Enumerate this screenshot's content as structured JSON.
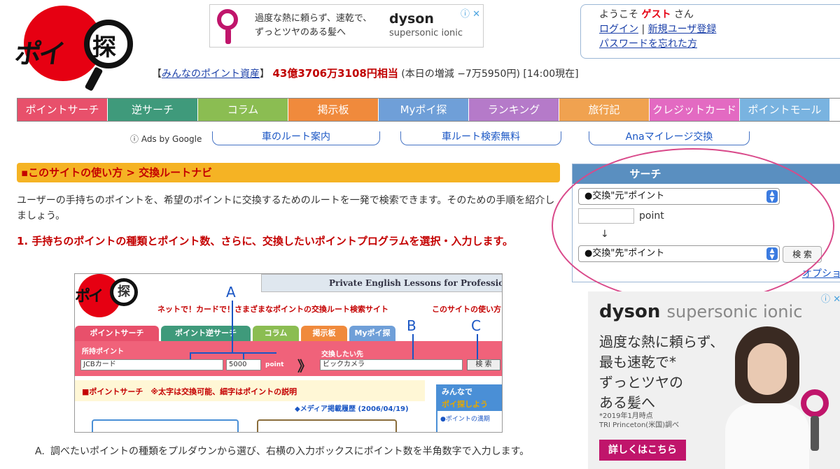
{
  "logo": {
    "text1": "ポイ",
    "text2": "探"
  },
  "top_ad": {
    "line1": "過度な熱に頼らず、速乾で、",
    "line2": "ずっとツヤのある髪へ",
    "brand": "dyson",
    "sub": "supersonic ionic",
    "close": "ⓘ ✕"
  },
  "login": {
    "welcome": "ようこそ",
    "guest": "ゲスト",
    "san": "さん",
    "login_link": "ログイン",
    "sep": "|",
    "register_link": "新規ユーザ登録",
    "forgot_link": "パスワードを忘れた方"
  },
  "assets": {
    "open": "【",
    "link": "みんなのポイント資産",
    "close": "】",
    "amount": "43億3706万3108円相当",
    "detail": "(本日の増減 −7万5950円) [14:00現在]"
  },
  "nav": [
    {
      "label": "ポイントサーチ",
      "color": "#e8506b"
    },
    {
      "label": "逆サーチ",
      "color": "#3f9a7b"
    },
    {
      "label": "コラム",
      "color": "#8bbd52"
    },
    {
      "label": "掲示板",
      "color": "#f08a3c"
    },
    {
      "label": "Myポイ探",
      "color": "#6f9fd8"
    },
    {
      "label": "ランキング",
      "color": "#b57ac9"
    },
    {
      "label": "旅行記",
      "color": "#f0a250"
    },
    {
      "label": "クレジットカード",
      "color": "#e36ac2"
    },
    {
      "label": "ポイントモール",
      "color": "#79b3e0"
    }
  ],
  "google_ads": {
    "label": "ⓘ Ads by Google",
    "links": [
      "車のルート案内",
      "車ルート検索無料",
      "Anaマイレージ交換"
    ]
  },
  "section": {
    "title": "▪このサイトの使い方 > 交換ルートナビ",
    "intro": "ユーザーの手持ちのポイントを、希望のポイントに交換するためのルートを一発で検索できます。そのための手順を紹介しましょう。",
    "step1": "1. 手持ちのポイントの種類とポイント数、さらに、交換したいポイントプログラムを選択・入力します。"
  },
  "figure": {
    "logo_text1": "ポイ",
    "logo_text2": "探",
    "banner": "Private English Lessons for Professionals",
    "tagline": "ネットで！カードで！さまざまなポイントの交換ルート検索サイト",
    "tagline2": "このサイトの使い方",
    "tabs": [
      "ポイントサーチ",
      "ポイント逆サーチ",
      "コラム",
      "掲示板",
      "Myポイ探"
    ],
    "held_label": "所持ポイント",
    "held_select": "JCBカード",
    "points": "5000",
    "point_unit": "point",
    "arrow": "》",
    "target_label": "交換したい先",
    "target_select": "ビックカメラ",
    "search_btn": "検 索",
    "section_title": "■ポイントサーチ　※太字は交換可能、細字はポイントの説明",
    "media": "◆メディア掲載履歴 (2006/04/19)",
    "side_head1": "みんなで",
    "side_head2": "ポイ探しよう",
    "side_link": "●ポイントの満期",
    "marker_a": "A",
    "marker_b": "B",
    "marker_c": "C"
  },
  "step_a": {
    "key": "A.",
    "text": "調べたいポイントの種類をプルダウンから選び、右横の入力ボックスにポイント数を半角数字で入力します。"
  },
  "search": {
    "title": "サーチ",
    "from_select": "●交換\"元\"ポイント",
    "point_label": "point",
    "arrow": "↓",
    "to_select": "●交換\"先\"ポイント",
    "button": "検 索",
    "options": "オプション"
  },
  "side_ad": {
    "brand": "dyson",
    "brand_sub": "supersonic ionic",
    "line1": "過度な熱に頼らず、",
    "line2": "最も速乾で*",
    "line3": "ずっとツヤの",
    "line4": "ある髪へ",
    "note1": "*2019年1月時点",
    "note2": "TRI Princeton(米国)調べ",
    "cta": "詳しくはこちら",
    "close": "ⓘ ✕"
  }
}
